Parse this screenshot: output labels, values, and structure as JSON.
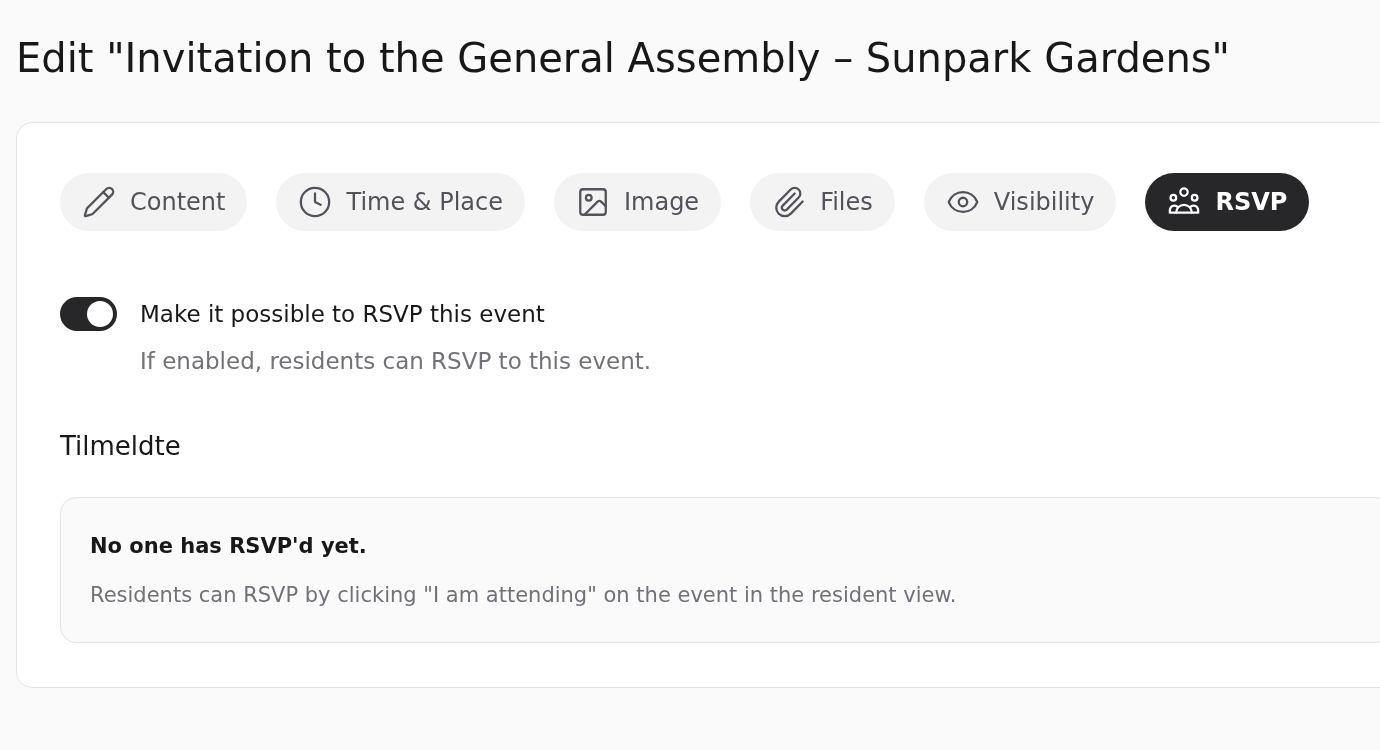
{
  "page": {
    "title": "Edit \"Invitation to the General Assembly – Sunpark Gardens\""
  },
  "tabs": [
    {
      "label": "Content",
      "selected": false
    },
    {
      "label": "Time & Place",
      "selected": false
    },
    {
      "label": "Image",
      "selected": false
    },
    {
      "label": "Files",
      "selected": false
    },
    {
      "label": "Visibility",
      "selected": false
    },
    {
      "label": "RSVP",
      "selected": true
    }
  ],
  "rsvp_toggle": {
    "on": true,
    "label": "Make it possible to RSVP this event",
    "description": "If enabled, residents can RSVP to this event."
  },
  "attendees": {
    "heading": "Tilmeldte",
    "empty_state": {
      "title": "No one has RSVP'd yet.",
      "description": "Residents can RSVP by clicking \"I am attending\" on the event in the resident view."
    }
  }
}
